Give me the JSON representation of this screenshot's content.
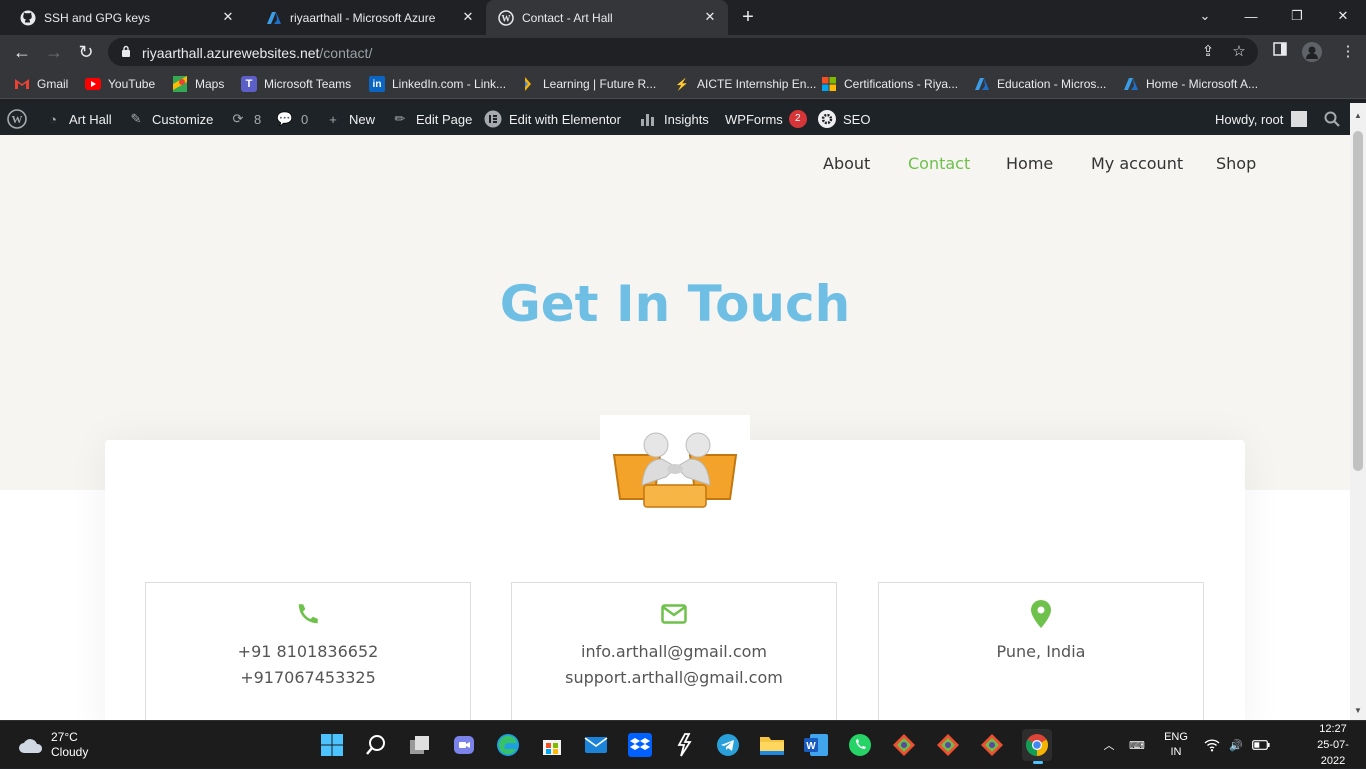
{
  "browser": {
    "tabs": [
      {
        "title": "SSH and GPG keys",
        "icon": "github-icon"
      },
      {
        "title": "riyaarthall - Microsoft Azure",
        "icon": "azure-icon"
      },
      {
        "title": "Contact - Art Hall",
        "icon": "wordpress-icon",
        "active": true
      }
    ],
    "url_host": "riyaarthall.azurewebsites.net",
    "url_path": "/contact/",
    "bookmarks": [
      {
        "label": "Gmail",
        "icon": "gmail-icon"
      },
      {
        "label": "YouTube",
        "icon": "youtube-icon"
      },
      {
        "label": "Maps",
        "icon": "maps-icon"
      },
      {
        "label": "Microsoft Teams",
        "icon": "teams-icon"
      },
      {
        "label": "LinkedIn.com - Link...",
        "icon": "linkedin-icon"
      },
      {
        "label": "Learning | Future R...",
        "icon": "future-skills-icon"
      },
      {
        "label": "AICTE Internship En...",
        "icon": "aicte-icon"
      },
      {
        "label": "Certifications - Riya...",
        "icon": "microsoft-icon"
      },
      {
        "label": "Education - Micros...",
        "icon": "azure-icon"
      },
      {
        "label": "Home - Microsoft A...",
        "icon": "azure-icon"
      }
    ]
  },
  "wp_admin_bar": {
    "site": "Art Hall",
    "customize": "Customize",
    "updates": "8",
    "comments": "0",
    "new": "New",
    "edit_page": "Edit Page",
    "elementor": "Edit with Elementor",
    "insights": "Insights",
    "wpforms": "WPForms",
    "wpforms_badge": "2",
    "seo": "SEO",
    "howdy": "Howdy, root"
  },
  "site": {
    "nav": [
      "About",
      "Contact",
      "Home",
      "My account",
      "Shop"
    ],
    "current_nav": "Contact",
    "heading": "Get In Touch",
    "contact_boxes": [
      {
        "icon": "phone-icon",
        "lines": [
          "+91 8101836652",
          "+917067453325"
        ]
      },
      {
        "icon": "envelope-icon",
        "lines": [
          "info.arthall@gmail.com",
          "support.arthall@gmail.com"
        ]
      },
      {
        "icon": "location-pin-icon",
        "lines": [
          "Pune, India",
          ""
        ]
      }
    ],
    "accent_color": "#6ec14a",
    "heading_color": "#6fbfe5"
  },
  "taskbar": {
    "temperature": "27°C",
    "condition": "Cloudy",
    "lang": "ENG",
    "region": "IN",
    "time": "12:27",
    "date": "25-07-2022"
  }
}
